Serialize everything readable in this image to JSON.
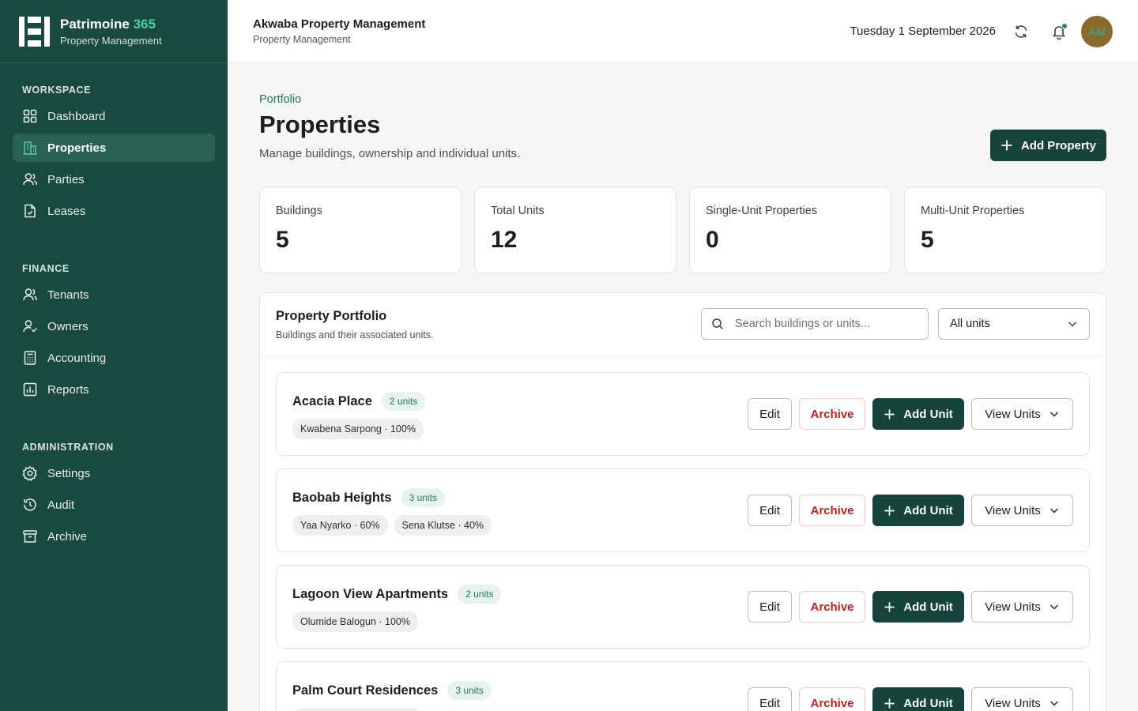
{
  "brand": {
    "name": "Patrimoine",
    "name_accent": "365",
    "subtitle": "Property Management"
  },
  "sidebar": {
    "sections": [
      {
        "title": "WORKSPACE",
        "items": [
          {
            "label": "Dashboard",
            "icon": "grid-icon"
          },
          {
            "label": "Properties",
            "icon": "building-icon",
            "active": true
          },
          {
            "label": "Parties",
            "icon": "users-icon"
          },
          {
            "label": "Leases",
            "icon": "document-icon"
          }
        ]
      },
      {
        "title": "FINANCE",
        "items": [
          {
            "label": "Tenants",
            "icon": "users-icon"
          },
          {
            "label": "Owners",
            "icon": "user-check-icon"
          },
          {
            "label": "Accounting",
            "icon": "calculator-icon"
          },
          {
            "label": "Reports",
            "icon": "chart-icon"
          }
        ]
      },
      {
        "title": "ADMINISTRATION",
        "items": [
          {
            "label": "Settings",
            "icon": "gear-icon"
          },
          {
            "label": "Audit",
            "icon": "history-icon"
          },
          {
            "label": "Archive",
            "icon": "archive-icon"
          }
        ]
      }
    ]
  },
  "header": {
    "org_name": "Akwaba Property Management",
    "org_subtitle": "Property Management",
    "date": "Tuesday 1 September 2026",
    "avatar_initials": "AM"
  },
  "page": {
    "eyebrow": "Portfolio",
    "title": "Properties",
    "subtitle": "Manage buildings, ownership and individual units.",
    "add_property_label": "Add Property"
  },
  "stats": [
    {
      "label": "Buildings",
      "value": "5"
    },
    {
      "label": "Total Units",
      "value": "12"
    },
    {
      "label": "Single-Unit Properties",
      "value": "0"
    },
    {
      "label": "Multi-Unit Properties",
      "value": "5"
    }
  ],
  "portfolio": {
    "title": "Property Portfolio",
    "subtitle": "Buildings and their associated units.",
    "search_placeholder": "Search buildings or units...",
    "filter_value": "All units",
    "actions": {
      "edit": "Edit",
      "archive": "Archive",
      "add_unit": "Add Unit",
      "view_units": "View Units"
    },
    "properties": [
      {
        "name": "Acacia Place",
        "units": "2 units",
        "owners": [
          "Kwabena Sarpong · 100%"
        ]
      },
      {
        "name": "Baobab Heights",
        "units": "3 units",
        "owners": [
          "Yaa Nyarko · 60%",
          "Sena Klutse · 40%"
        ]
      },
      {
        "name": "Lagoon View Apartments",
        "units": "2 units",
        "owners": [
          "Olumide Balogun · 100%"
        ]
      },
      {
        "name": "Palm Court Residences",
        "units": "3 units",
        "owners": [
          ""
        ]
      }
    ]
  },
  "colors": {
    "sidebar": "#1a4a3f",
    "primary": "#17443a",
    "accent": "#4fd1a0",
    "danger": "#b3261e"
  }
}
